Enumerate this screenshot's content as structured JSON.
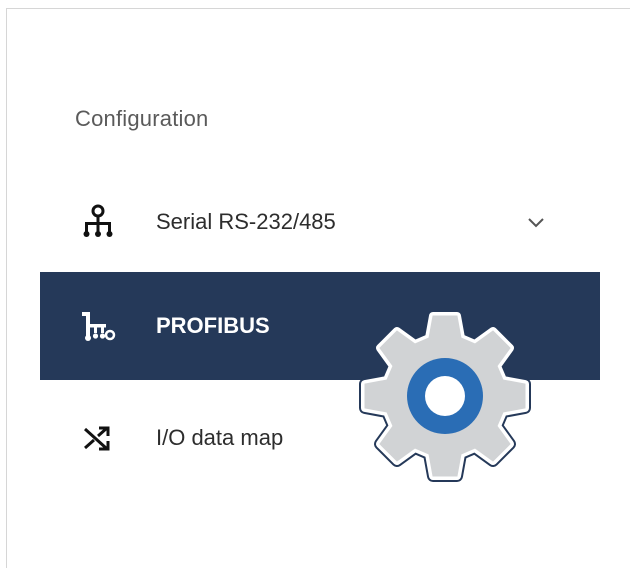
{
  "sidebar": {
    "section_title": "Configuration",
    "items": [
      {
        "label": "Serial RS-232/485",
        "icon": "network-tree-icon",
        "expandable": true,
        "active": false
      },
      {
        "label": "PROFIBUS",
        "icon": "profibus-bus-icon",
        "expandable": false,
        "active": true
      },
      {
        "label": "I/O data map",
        "icon": "shuffle-map-icon",
        "expandable": false,
        "active": false
      }
    ]
  },
  "overlay": {
    "icon": "settings-gear-icon"
  },
  "colors": {
    "active_bg": "#253959",
    "active_text": "#ffffff",
    "text": "#2d2d2d",
    "section_title": "#5a5a5a",
    "gear_fill": "#d1d3d5",
    "gear_ring": "#2a6db5"
  }
}
